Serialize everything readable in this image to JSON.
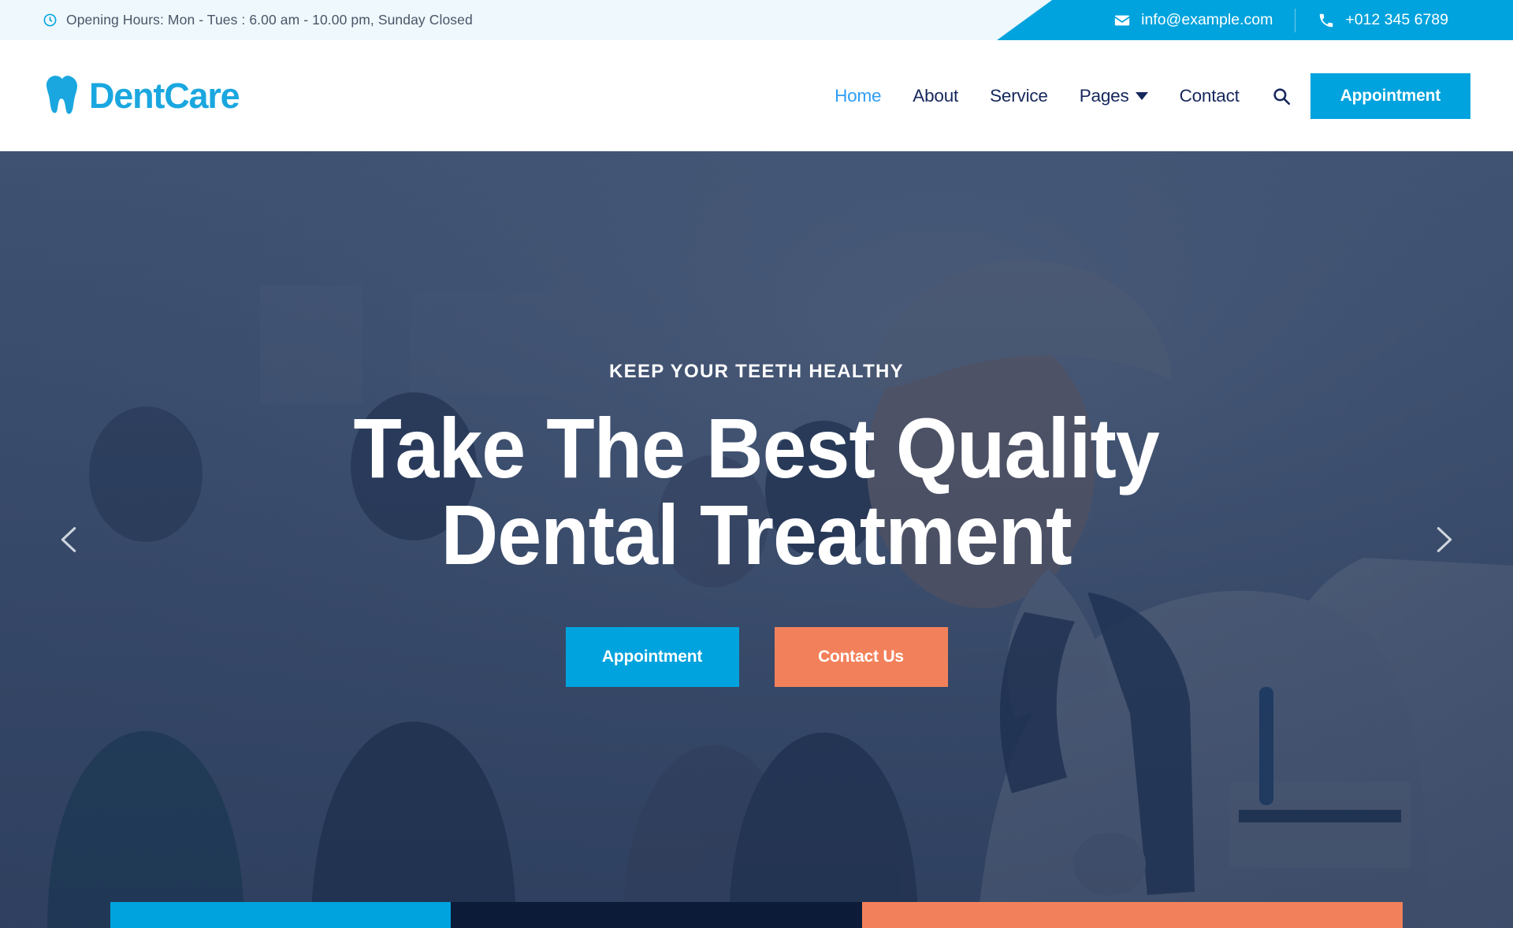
{
  "topbar": {
    "hours_icon": "clock-icon",
    "hours": "Opening Hours: Mon - Tues : 6.00 am - 10.00 pm, Sunday Closed",
    "email_icon": "envelope-icon",
    "email": "info@example.com",
    "phone_icon": "phone-icon",
    "phone": "+012 345 6789",
    "bg": "#eef8fd",
    "accent": "#00a3dd"
  },
  "header": {
    "logo_icon": "tooth-icon",
    "logo_text": "DentCare",
    "logo_color": "#1aa7e0",
    "nav": [
      {
        "label": "Home",
        "active": true,
        "has_dropdown": false
      },
      {
        "label": "About",
        "active": false,
        "has_dropdown": false
      },
      {
        "label": "Service",
        "active": false,
        "has_dropdown": false
      },
      {
        "label": "Pages",
        "active": false,
        "has_dropdown": true
      },
      {
        "label": "Contact",
        "active": false,
        "has_dropdown": false
      }
    ],
    "search_icon": "search-icon",
    "appointment_label": "Appointment",
    "appointment_color": "#00a3dd",
    "active_color": "#2e9ef5",
    "nav_color": "#16275c"
  },
  "hero": {
    "kicker": "KEEP YOUR TEETH HEALTHY",
    "headline_line1": "Take The Best Quality",
    "headline_line2": "Dental Treatment",
    "primary_button": "Appointment",
    "secondary_button": "Contact Us",
    "primary_color": "#00a3dd",
    "secondary_color": "#f2815b",
    "prev_icon": "chevron-left-icon",
    "next_icon": "chevron-right-icon",
    "overlay_color": "#1e3052"
  },
  "panels": [
    {
      "name": "panel-one",
      "color": "#00a3dd"
    },
    {
      "name": "panel-two",
      "color": "#0c1c38"
    },
    {
      "name": "panel-three",
      "color": "#f2815b"
    }
  ]
}
